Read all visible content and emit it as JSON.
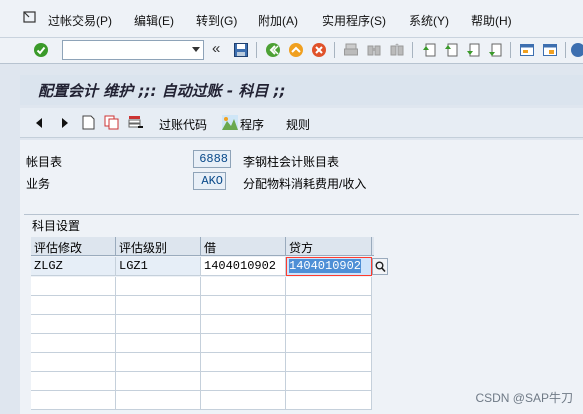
{
  "menu": {
    "items": [
      "过帐交易(P)",
      "编辑(E)",
      "转到(G)",
      "附加(A)",
      "实用程序(S)",
      "系统(Y)",
      "帮助(H)"
    ]
  },
  "toolbar": {
    "command_value": "",
    "icons": [
      "enter-icon",
      "save-icon",
      "back-icon",
      "exit-icon",
      "cancel-icon",
      "print-icon",
      "find-icon",
      "find-next-icon",
      "first-page-icon",
      "prev-page-icon",
      "next-page-icon",
      "last-page-icon",
      "create-session-icon",
      "shortcut-icon",
      "help-icon"
    ]
  },
  "title": "配置会计 维护 ;;: 自动过账 - 科目 ;;",
  "app_toolbar": {
    "posting_key": "过账代码",
    "procedures": "程序",
    "rules": "规则"
  },
  "fields": {
    "chart_of_accounts_label": "帐目表",
    "chart_of_accounts_value": "6888",
    "chart_of_accounts_desc": "李钢柱会计账目表",
    "transaction_label": "业务",
    "transaction_value": "AKO",
    "transaction_desc": "分配物料消耗费用/收入"
  },
  "group": {
    "title": "科目设置",
    "columns": [
      "评估修改",
      "评估级别",
      "借",
      "贷方"
    ],
    "rows": [
      [
        "ZLGZ",
        "LGZ1",
        "1404010902",
        "1404010902"
      ]
    ]
  },
  "watermark": "CSDN @SAP牛刀"
}
